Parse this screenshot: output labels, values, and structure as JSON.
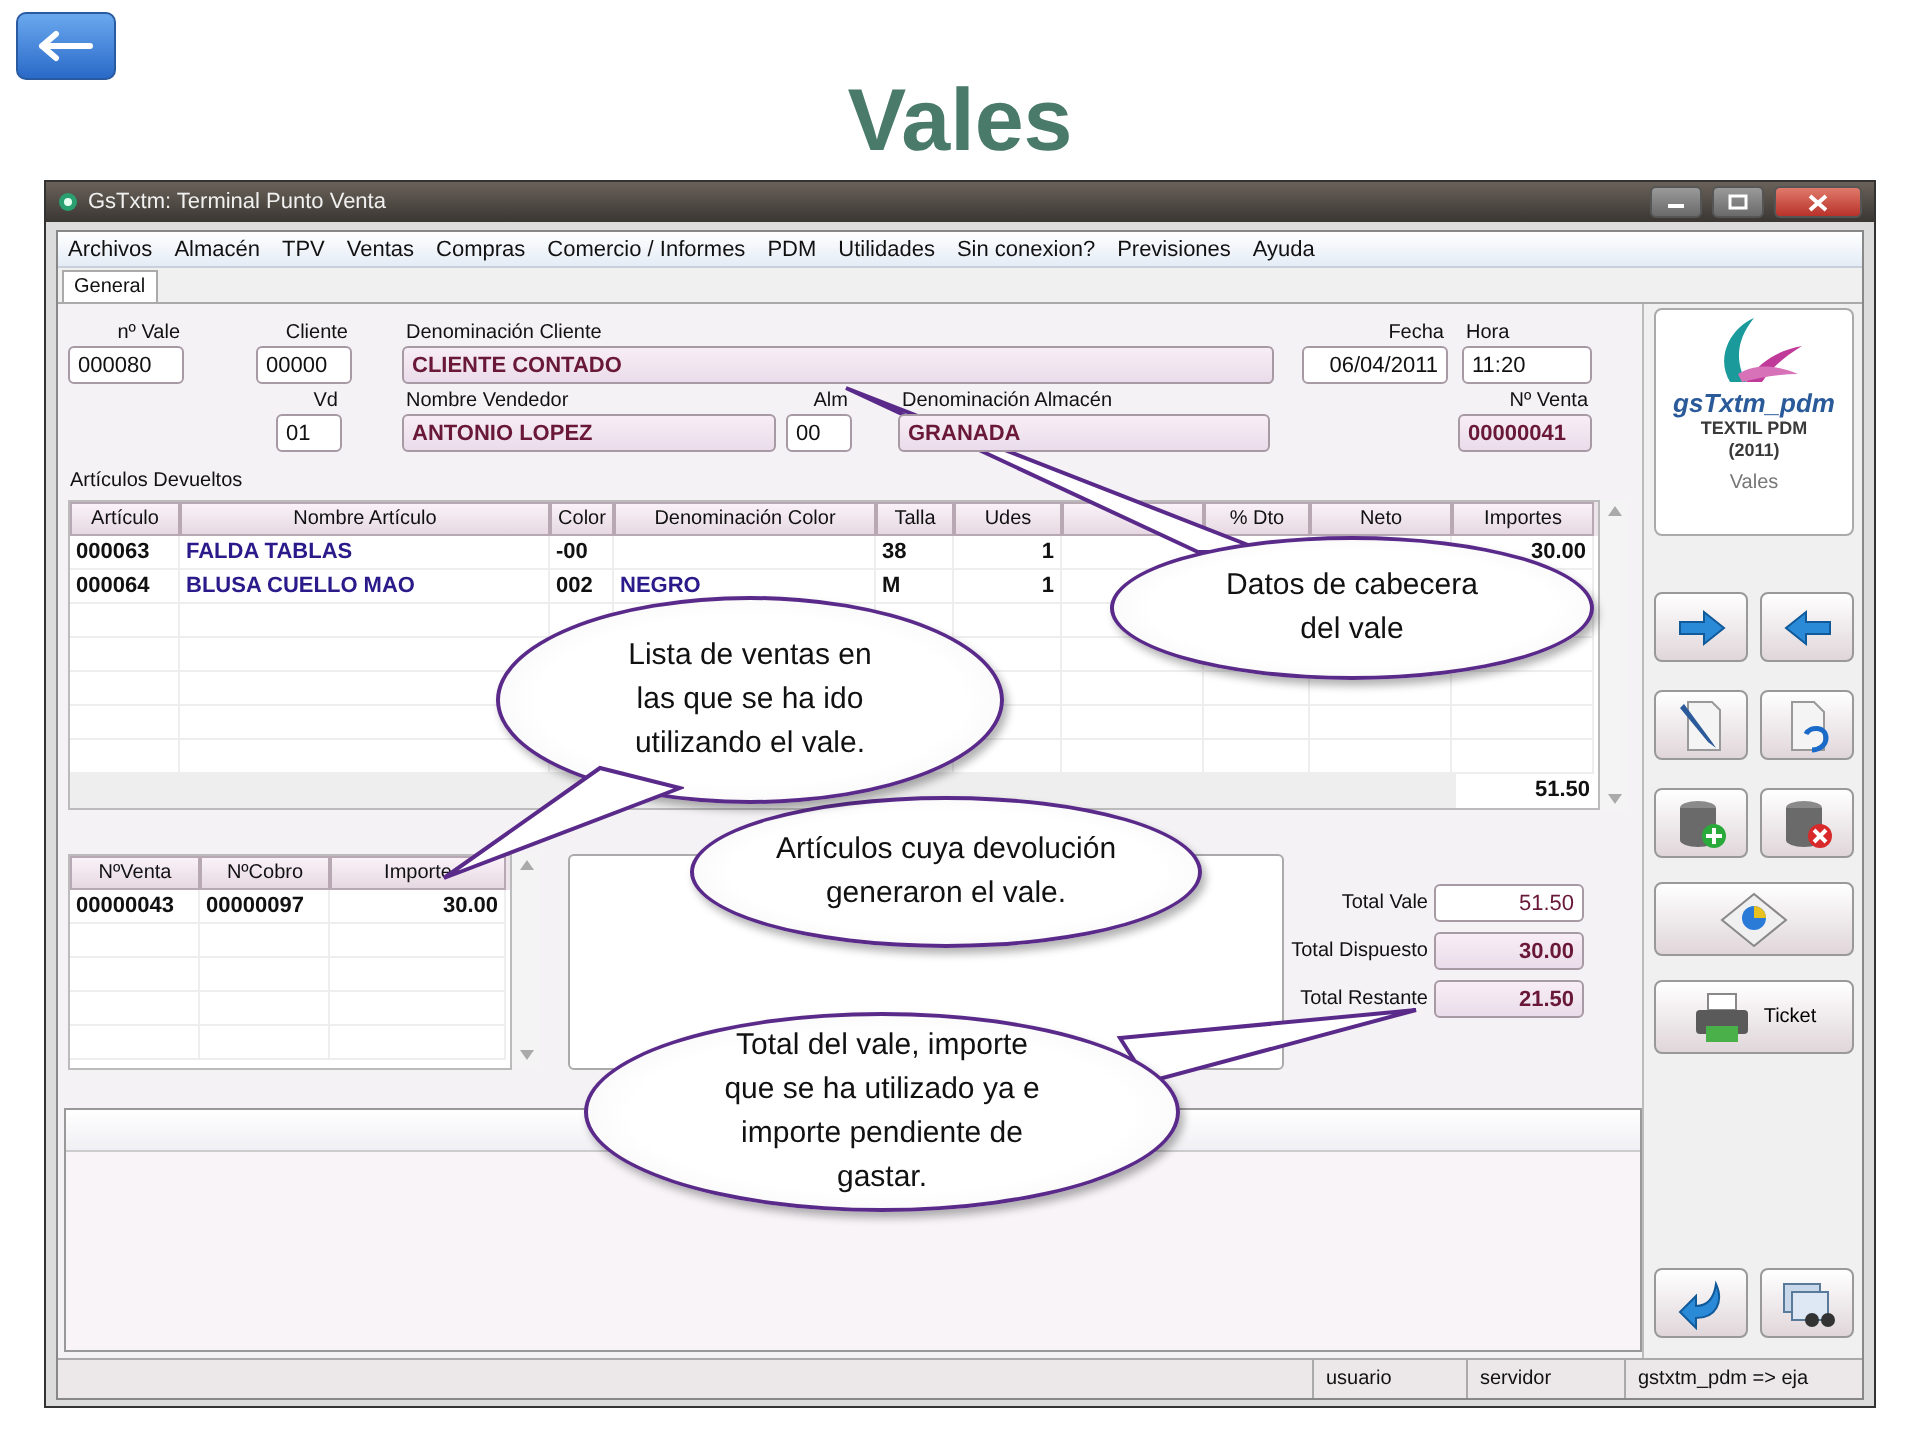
{
  "slide_title": "Vales",
  "window": {
    "title": "GsTxtm: Terminal Punto Venta"
  },
  "menu": [
    "Archivos",
    "Almacén",
    "TPV",
    "Ventas",
    "Compras",
    "Comercio / Informes",
    "PDM",
    "Utilidades",
    "Sin conexion?",
    "Previsiones",
    "Ayuda"
  ],
  "tabs": [
    {
      "label": "General",
      "selected": true
    }
  ],
  "header_rows": [
    [
      {
        "label": "nº Vale",
        "value": "000080",
        "readonly": false
      },
      {
        "label": "Cliente",
        "value": "00000",
        "readonly": false
      },
      {
        "label": "Denominación Cliente",
        "value": "CLIENTE CONTADO",
        "readonly": true
      },
      {
        "label": "Fecha",
        "value": "06/04/2011",
        "readonly": false
      },
      {
        "label": "Hora",
        "value": "11:20",
        "readonly": false
      }
    ],
    [
      {
        "label": "Vd",
        "value": "01",
        "readonly": false
      },
      {
        "label": "Nombre Vendedor",
        "value": "ANTONIO LOPEZ",
        "readonly": true
      },
      {
        "label": "Alm",
        "value": "00",
        "readonly": false
      },
      {
        "label": "Denominación Almacén",
        "value": "GRANADA",
        "readonly": true
      },
      {
        "label": "Nº Venta",
        "value": "00000041",
        "readonly": true
      }
    ]
  ],
  "returned_items": {
    "title": "Artículos Devueltos",
    "columns": [
      "Artículo",
      "Nombre Artículo",
      "Color",
      "Denominación Color",
      "Talla",
      "Udes",
      null,
      "% Dto",
      "Neto",
      "Importes"
    ],
    "rows": [
      [
        "000063",
        "FALDA TABLAS",
        "-00",
        null,
        "38",
        "1",
        null,
        null,
        null,
        "30.00"
      ],
      [
        "000064",
        "BLUSA CUELLO MAO",
        "002",
        "NEGRO",
        "M",
        "1",
        null,
        null,
        null,
        null
      ]
    ],
    "total": "51.50"
  },
  "sales_table": {
    "columns": [
      "NºVenta",
      "NºCobro",
      "Importe"
    ],
    "rows": [
      [
        "00000043",
        "00000097",
        "30.00"
      ]
    ]
  },
  "totals": [
    {
      "label": "Total Vale",
      "value": "51.50",
      "readonly": false
    },
    {
      "label": "Total Dispuesto",
      "value": "30.00",
      "readonly": true
    },
    {
      "label": "Total Restante",
      "value": "21.50",
      "readonly": true
    }
  ],
  "brand": {
    "name": "gsTxtm_pdm",
    "line1": "TEXTIL PDM",
    "line2": "(2011)",
    "module": "Vales"
  },
  "ticket_button": "Ticket",
  "status_bar": [
    "usuario",
    "servidor",
    "gstxtm_pdm => eja"
  ],
  "callouts": [
    "Datos de cabecera del vale",
    "Lista de ventas en las que se ha ido utilizando el vale.",
    "Artículos cuya devolución generaron el vale.",
    "Total del vale, importe que se ha utilizado ya e importe pendiente de gastar."
  ]
}
